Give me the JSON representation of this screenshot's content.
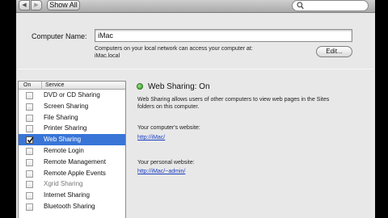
{
  "toolbar": {
    "back_glyph": "◀",
    "forward_glyph": "▶",
    "show_all_label": "Show All",
    "search_placeholder": ""
  },
  "computer_name": {
    "label": "Computer Name:",
    "value": "iMac",
    "note_line1": "Computers on your local network can access your computer at:",
    "note_line2": "iMac.local",
    "edit_label": "Edit..."
  },
  "services": {
    "header_on": "On",
    "header_service": "Service",
    "items": [
      {
        "label": "DVD or CD Sharing",
        "checked": false
      },
      {
        "label": "Screen Sharing",
        "checked": false
      },
      {
        "label": "File Sharing",
        "checked": false
      },
      {
        "label": "Printer Sharing",
        "checked": false
      },
      {
        "label": "Web Sharing",
        "checked": true
      },
      {
        "label": "Remote Login",
        "checked": false
      },
      {
        "label": "Remote Management",
        "checked": false
      },
      {
        "label": "Remote Apple Events",
        "checked": false
      },
      {
        "label": "Xgrid Sharing",
        "checked": false
      },
      {
        "label": "Internet Sharing",
        "checked": false
      },
      {
        "label": "Bluetooth Sharing",
        "checked": false
      }
    ],
    "selected_index": 4
  },
  "detail": {
    "status": "Web Sharing: On",
    "status_color": "#3aa52a",
    "description_line1": "Web Sharing allows users of other computers to view web pages in the Sites",
    "description_line2": "folders on this computer.",
    "computer_site_label": "Your computer's website:",
    "computer_site_url": "http://iMac/",
    "personal_site_label": "Your personal website:",
    "personal_site_url": "http://iMac/~admin/"
  }
}
